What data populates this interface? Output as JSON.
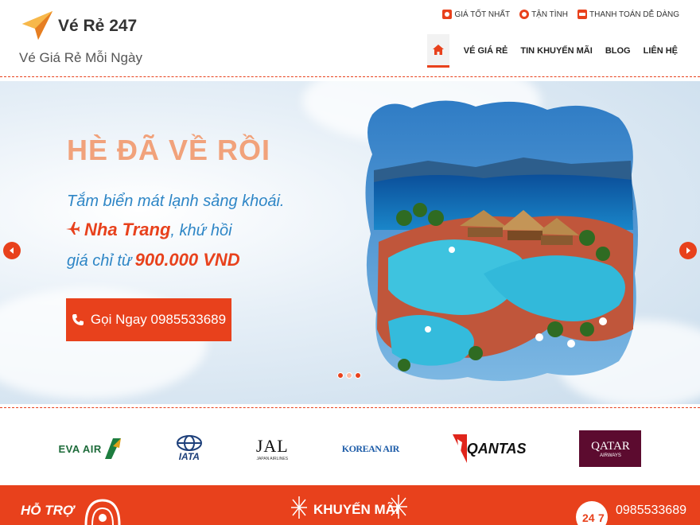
{
  "brand": {
    "name": "Vé Rẻ 247",
    "tagline": "Vé Giá Rẻ Mỗi Ngày"
  },
  "utilities": [
    {
      "label": "GIÁ TỐT NHẤT",
      "icon": "price-tag-icon"
    },
    {
      "label": "TẬN TÌNH",
      "icon": "support-icon"
    },
    {
      "label": "THANH TOÁN DỄ DÀNG",
      "icon": "payment-icon"
    }
  ],
  "nav": {
    "home_icon": "home-icon",
    "items": [
      "VÉ GIÁ RẺ",
      "TIN KHUYẾN MÃI",
      "BLOG",
      "LIÊN HỆ"
    ]
  },
  "hero": {
    "title": "HÈ ĐÃ VỀ RỒI",
    "line1": "Tắm biển mát lạnh sảng khoái.",
    "destination": "Nha Trang",
    "line2_suffix": ", khứ hồi",
    "line3_prefix": "giá chỉ từ",
    "price": "900.000 VND",
    "cta_label": "Gọi Ngay 0985533689",
    "slides_total": 3,
    "active_slide": 1
  },
  "partners": [
    {
      "name": "EVA AIR",
      "icon": "eva-air-logo"
    },
    {
      "name": "IATA",
      "icon": "iata-logo"
    },
    {
      "name": "JAL",
      "sub": "JAPAN AIRLINES",
      "icon": "jal-logo"
    },
    {
      "name": "KOREAN AIR",
      "icon": "korean-air-logo"
    },
    {
      "name": "QANTAS",
      "icon": "qantas-logo"
    },
    {
      "name": "QATAR",
      "sub": "AIRWAYS",
      "icon": "qatar-airways-logo"
    }
  ],
  "footer": {
    "support_label": "HỖ TRỢ",
    "promo_label": "KHUYẾN MÃI",
    "phone": "0985533689"
  },
  "colors": {
    "accent": "#e8411c",
    "hero_text_blue": "#2e86c6",
    "hero_title": "#f1a27b"
  }
}
